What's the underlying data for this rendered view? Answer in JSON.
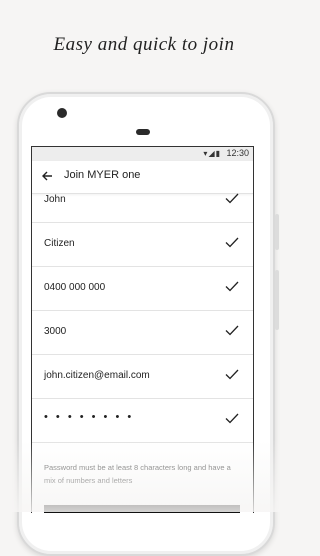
{
  "headline": "Easy and quick to join",
  "status": {
    "time": "12:30",
    "icons": "▾◢▮"
  },
  "appbar": {
    "title": "Join MYER one"
  },
  "fields": [
    {
      "value": "John"
    },
    {
      "value": "Citizen"
    },
    {
      "value": "0400 000 000"
    },
    {
      "value": "3000"
    },
    {
      "value": "john.citizen@email.com"
    },
    {
      "value": "• • • • • • • •"
    }
  ],
  "helper_text": "Password must be at least 8 characters long and have a mix of numbers and letters",
  "icons": {
    "back": "arrow-left-icon",
    "check": "checkmark-icon"
  },
  "colors": {
    "accent": "#111111",
    "divider": "#e3e3e3",
    "background": "#f6f5f4"
  }
}
